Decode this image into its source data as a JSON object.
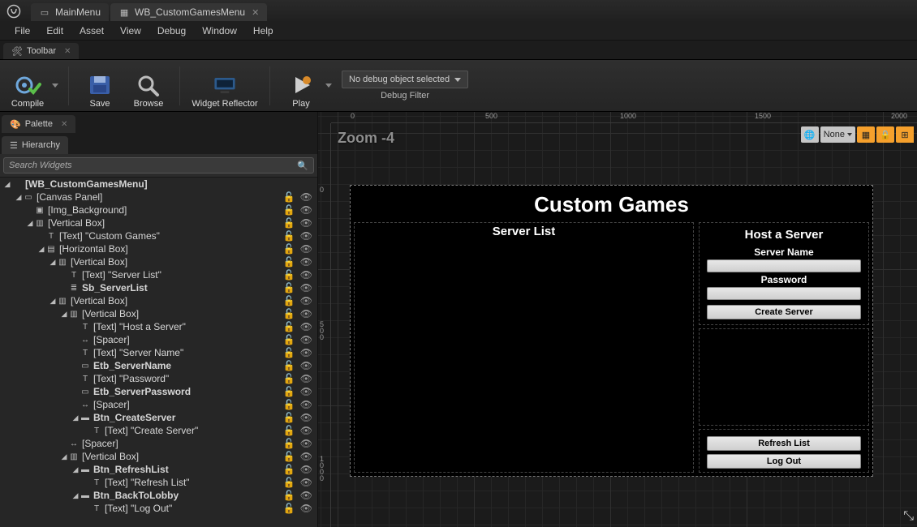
{
  "tabs": [
    {
      "label": "MainMenu",
      "icon": "layout-icon"
    },
    {
      "label": "WB_CustomGamesMenu",
      "icon": "widget-bp-icon"
    }
  ],
  "menu": [
    "File",
    "Edit",
    "Asset",
    "View",
    "Debug",
    "Window",
    "Help"
  ],
  "toolbar_tab_label": "Toolbar",
  "toolbar": {
    "compile": "Compile",
    "save": "Save",
    "browse": "Browse",
    "reflector": "Widget Reflector",
    "play": "Play",
    "debug_selected": "No debug object selected",
    "debug_filter": "Debug Filter"
  },
  "left_tabs": {
    "palette": "Palette",
    "hierarchy": "Hierarchy"
  },
  "search_placeholder": "Search Widgets",
  "hierarchy": [
    {
      "d": 0,
      "e": true,
      "i": "root",
      "t": "[WB_CustomGamesMenu]",
      "b": true
    },
    {
      "d": 1,
      "e": true,
      "i": "canvas",
      "t": "[Canvas Panel]"
    },
    {
      "d": 2,
      "e": false,
      "i": "image",
      "t": "[Img_Background]"
    },
    {
      "d": 2,
      "e": true,
      "i": "vbox",
      "t": "[Vertical Box]"
    },
    {
      "d": 3,
      "e": false,
      "i": "text",
      "t": "[Text] \"Custom Games\""
    },
    {
      "d": 3,
      "e": true,
      "i": "hbox",
      "t": "[Horizontal Box]"
    },
    {
      "d": 4,
      "e": true,
      "i": "vbox",
      "t": "[Vertical Box]"
    },
    {
      "d": 5,
      "e": false,
      "i": "text",
      "t": "[Text] \"Server List\""
    },
    {
      "d": 5,
      "e": false,
      "i": "scroll",
      "t": "Sb_ServerList",
      "b": true
    },
    {
      "d": 4,
      "e": true,
      "i": "vbox",
      "t": "[Vertical Box]"
    },
    {
      "d": 5,
      "e": true,
      "i": "vbox",
      "t": "[Vertical Box]"
    },
    {
      "d": 6,
      "e": false,
      "i": "text",
      "t": "[Text] \"Host a Server\""
    },
    {
      "d": 6,
      "e": false,
      "i": "spacer",
      "t": "[Spacer]"
    },
    {
      "d": 6,
      "e": false,
      "i": "text",
      "t": "[Text] \"Server Name\""
    },
    {
      "d": 6,
      "e": false,
      "i": "edit",
      "t": "Etb_ServerName",
      "b": true
    },
    {
      "d": 6,
      "e": false,
      "i": "text",
      "t": "[Text] \"Password\""
    },
    {
      "d": 6,
      "e": false,
      "i": "edit",
      "t": "Etb_ServerPassword",
      "b": true
    },
    {
      "d": 6,
      "e": false,
      "i": "spacer",
      "t": "[Spacer]"
    },
    {
      "d": 6,
      "e": true,
      "i": "button",
      "t": "Btn_CreateServer",
      "b": true
    },
    {
      "d": 7,
      "e": false,
      "i": "text",
      "t": "[Text] \"Create Server\""
    },
    {
      "d": 5,
      "e": false,
      "i": "spacer",
      "t": "[Spacer]"
    },
    {
      "d": 5,
      "e": true,
      "i": "vbox",
      "t": "[Vertical Box]"
    },
    {
      "d": 6,
      "e": true,
      "i": "button",
      "t": "Btn_RefreshList",
      "b": true
    },
    {
      "d": 7,
      "e": false,
      "i": "text",
      "t": "[Text] \"Refresh List\""
    },
    {
      "d": 6,
      "e": true,
      "i": "button",
      "t": "Btn_BackToLobby",
      "b": true
    },
    {
      "d": 7,
      "e": false,
      "i": "text",
      "t": "[Text] \"Log Out\""
    }
  ],
  "viewport": {
    "zoom_label": "Zoom -4",
    "ruler_h": [
      "0",
      "500",
      "1000",
      "1500",
      "2000"
    ],
    "ruler_v": [
      "0",
      "500",
      "1000"
    ],
    "none_label": "None"
  },
  "ui_preview": {
    "title": "Custom Games",
    "server_list": "Server List",
    "host_title": "Host a Server",
    "server_name": "Server Name",
    "password": "Password",
    "create": "Create Server",
    "refresh": "Refresh List",
    "logout": "Log Out"
  }
}
